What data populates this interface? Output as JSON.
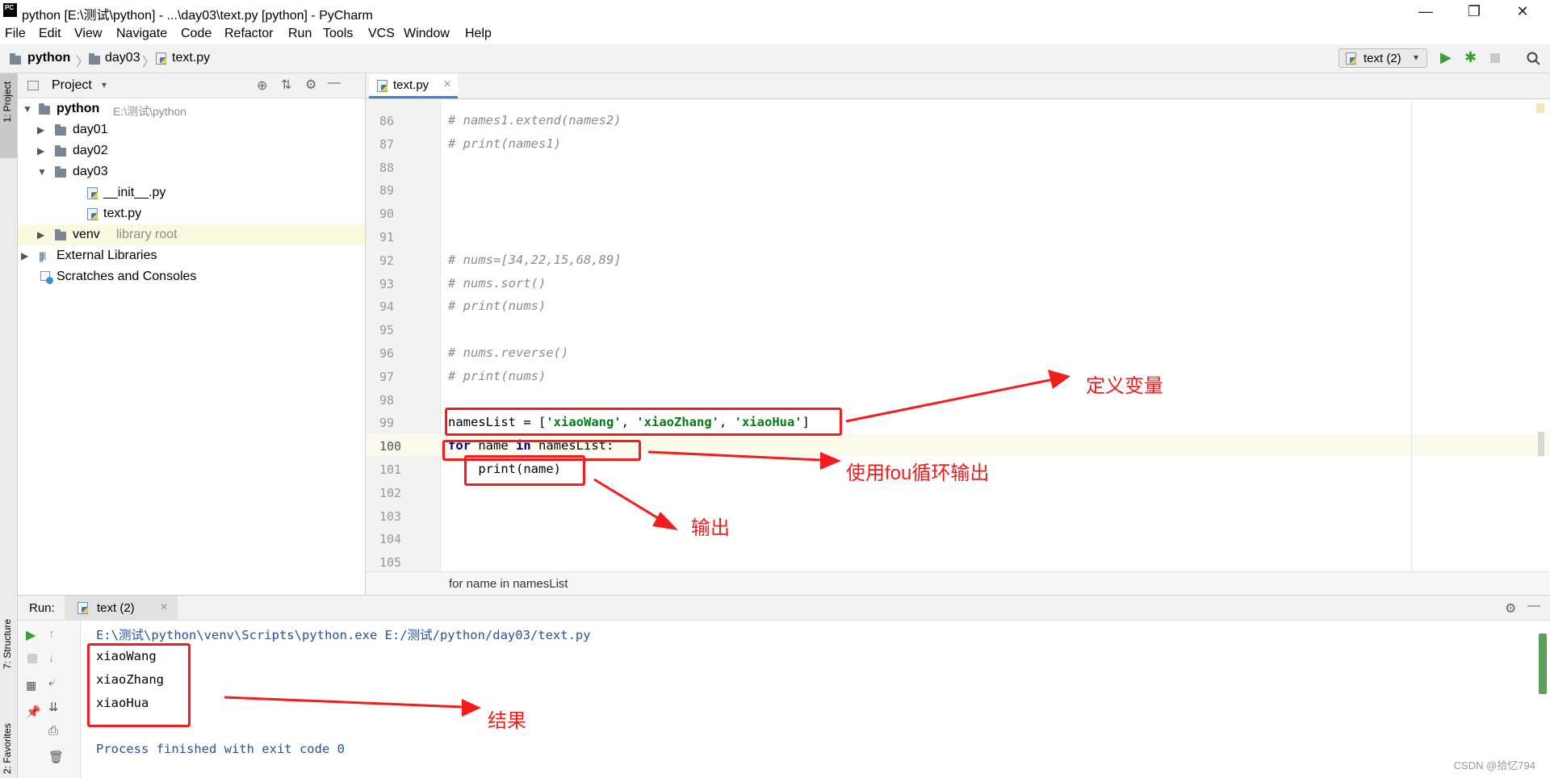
{
  "window": {
    "title": "python [E:\\测试\\python] - ...\\day03\\text.py [python] - PyCharm",
    "minimize": "—",
    "maximize": "❐",
    "close": "✕"
  },
  "menu": [
    "File",
    "Edit",
    "View",
    "Navigate",
    "Code",
    "Refactor",
    "Run",
    "Tools",
    "VCS",
    "Window",
    "Help"
  ],
  "nav": {
    "crumbs": [
      "python",
      "day03",
      "text.py"
    ],
    "run_config": "text (2)"
  },
  "left_stripe": {
    "project": "1: Project",
    "structure": "7: Structure",
    "favorites": "2: Favorites"
  },
  "project": {
    "header": "Project",
    "root_name": "python",
    "root_path": "E:\\测试\\python",
    "items": [
      {
        "label": "day01"
      },
      {
        "label": "day02"
      },
      {
        "label": "day03"
      },
      {
        "label": "__init__.py"
      },
      {
        "label": "text.py"
      },
      {
        "label": "venv",
        "hint": "library root"
      },
      {
        "label": "External Libraries"
      },
      {
        "label": "Scratches and Consoles"
      }
    ]
  },
  "editor": {
    "tab": "text.py",
    "lines": [
      {
        "n": "86",
        "t": "# names1.extend(names2)"
      },
      {
        "n": "87",
        "t": "# print(names1)"
      },
      {
        "n": "88",
        "t": ""
      },
      {
        "n": "89",
        "t": ""
      },
      {
        "n": "90",
        "t": ""
      },
      {
        "n": "91",
        "t": ""
      },
      {
        "n": "92",
        "t": "# nums=[34,22,15,68,89]"
      },
      {
        "n": "93",
        "t": "# nums.sort()"
      },
      {
        "n": "94",
        "t": "# print(nums)"
      },
      {
        "n": "95",
        "t": ""
      },
      {
        "n": "96",
        "t": "# nums.reverse()"
      },
      {
        "n": "97",
        "t": "# print(nums)"
      },
      {
        "n": "98",
        "t": ""
      },
      {
        "n": "99",
        "t": ""
      },
      {
        "n": "100",
        "t": ""
      },
      {
        "n": "101",
        "t": ""
      },
      {
        "n": "102",
        "t": ""
      },
      {
        "n": "103",
        "t": ""
      },
      {
        "n": "104",
        "t": ""
      },
      {
        "n": "105",
        "t": ""
      }
    ],
    "line99": {
      "a": "namesList = [",
      "s1": "'xiaoWang'",
      "c1": ", ",
      "s2": "'xiaoZhang'",
      "c2": ", ",
      "s3": "'xiaoHua'",
      "b": "]"
    },
    "line100": {
      "kw1": "for",
      "a": " name ",
      "kw2": "in",
      "b": " namesList:"
    },
    "line101": "    print(name)",
    "breadcrumb": "for name in namesList"
  },
  "run": {
    "label": "Run:",
    "tab": "text (2)",
    "command": "E:\\测试\\python\\venv\\Scripts\\python.exe E:/测试/python/day03/text.py",
    "output": [
      "xiaoWang",
      "xiaoZhang",
      "xiaoHua"
    ],
    "exit": "Process finished with exit code 0"
  },
  "annotations": {
    "define": "定义变量",
    "loop": "使用fou循环输出",
    "output": "输出",
    "result": "结果"
  },
  "watermark": "CSDN @拾忆794"
}
